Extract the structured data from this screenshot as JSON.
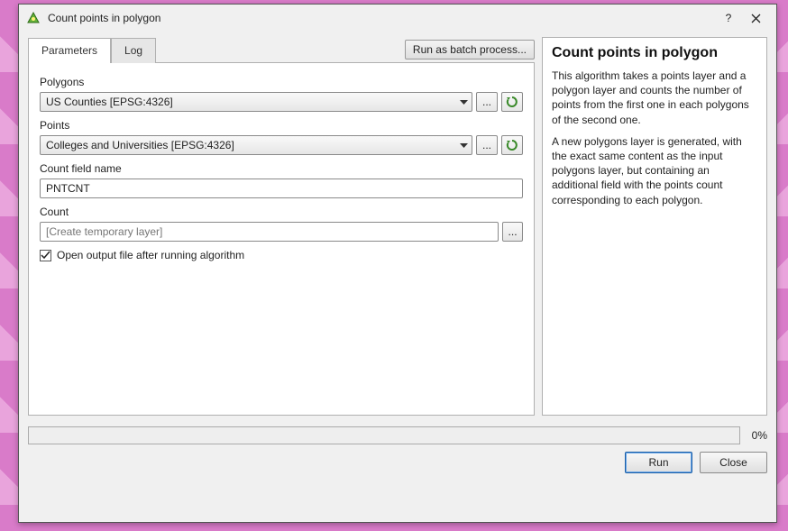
{
  "window": {
    "title": "Count points in polygon"
  },
  "tabs": {
    "parameters": "Parameters",
    "log": "Log"
  },
  "batch_button": "Run as batch process...",
  "fields": {
    "polygons_label": "Polygons",
    "polygons_value": "US Counties [EPSG:4326]",
    "points_label": "Points",
    "points_value": "Colleges and Universities [EPSG:4326]",
    "countfield_label": "Count field name",
    "countfield_value": "PNTCNT",
    "count_label": "Count",
    "count_placeholder": "[Create temporary layer]",
    "open_output_label": "Open output file after running algorithm"
  },
  "help": {
    "title": "Count points in polygon",
    "p1": "This algorithm takes a points layer and a polygon layer and counts the number of points from the first one in each polygons of the second one.",
    "p2": "A new polygons layer is generated, with the exact same content as the input polygons layer, but containing an additional field with the points count corresponding to each polygon."
  },
  "progress_pct": "0%",
  "buttons": {
    "run": "Run",
    "close": "Close"
  },
  "icons": {
    "ellipsis": "..."
  }
}
